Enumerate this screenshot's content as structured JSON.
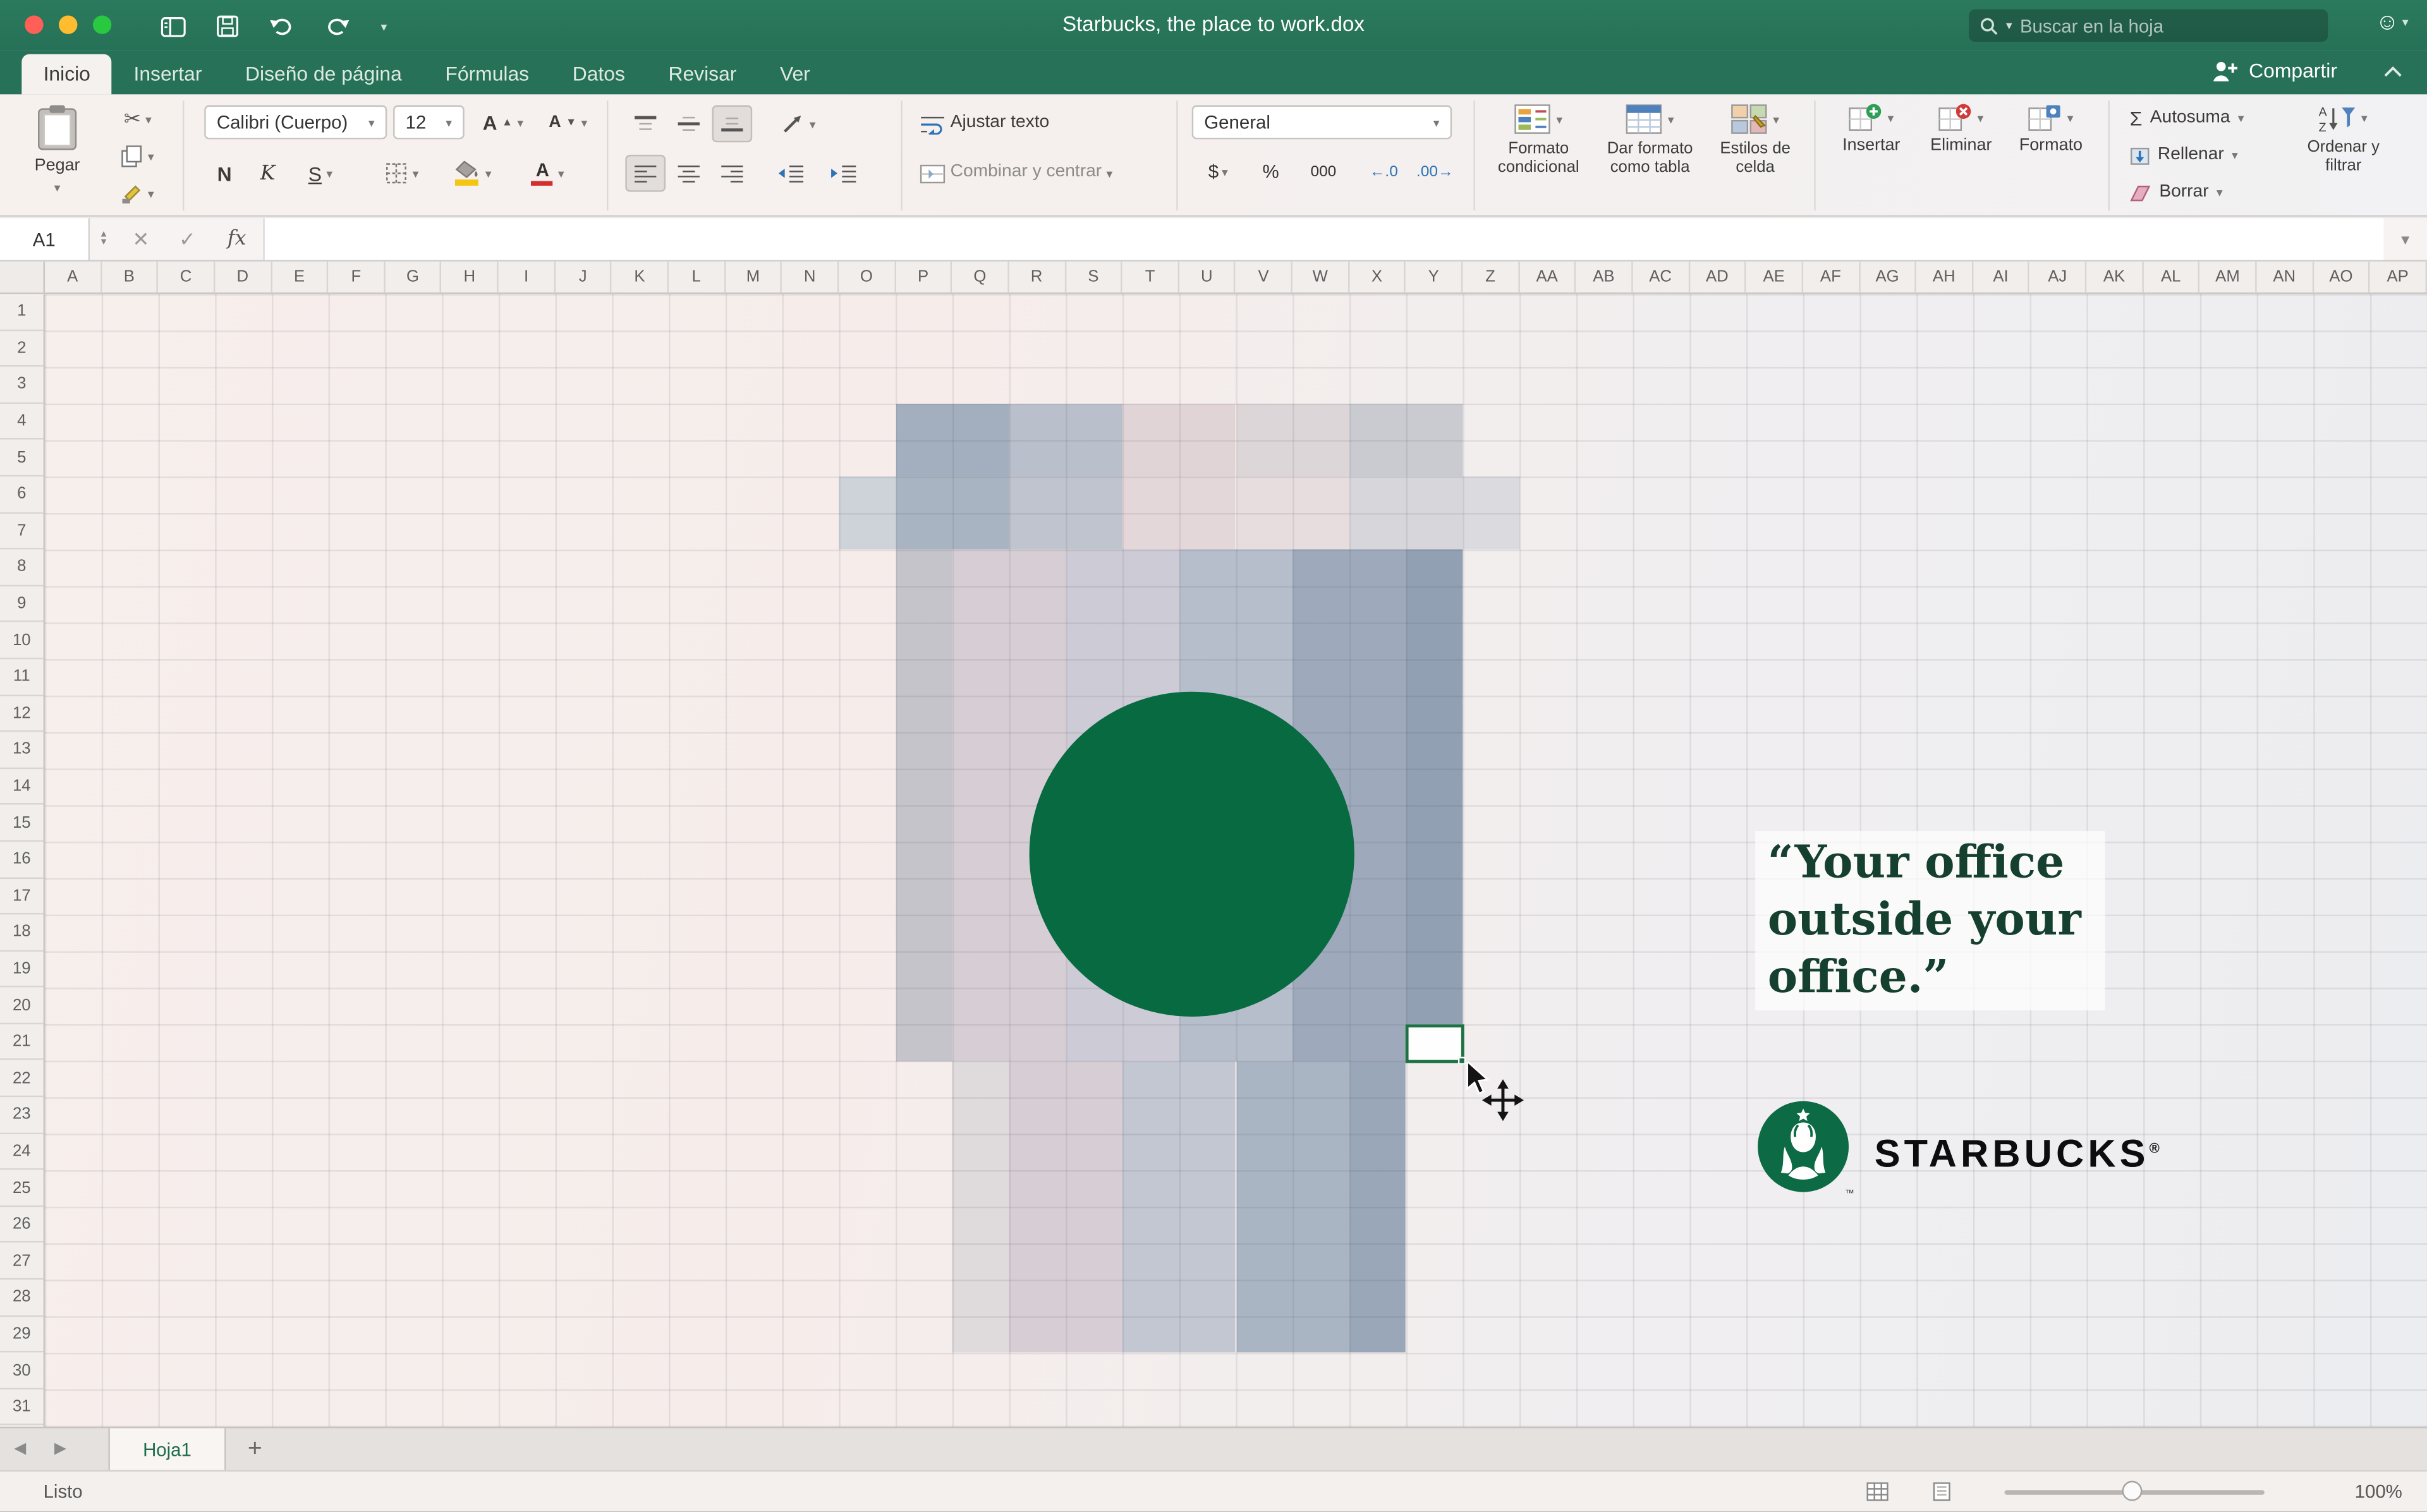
{
  "window": {
    "title": "Starbucks, the place to work.dox",
    "search_placeholder": "Buscar en la hoja"
  },
  "menu_tabs": [
    {
      "label": "Inicio",
      "active": true
    },
    {
      "label": "Insertar",
      "active": false
    },
    {
      "label": "Diseño de página",
      "active": false
    },
    {
      "label": "Fórmulas",
      "active": false
    },
    {
      "label": "Datos",
      "active": false
    },
    {
      "label": "Revisar",
      "active": false
    },
    {
      "label": "Ver",
      "active": false
    }
  ],
  "share_label": "Compartir",
  "ribbon": {
    "paste": "Pegar",
    "font_name": "Calibri (Cuerpo)",
    "font_size": "12",
    "bold": "N",
    "italic": "K",
    "underline": "S",
    "wrap_text": "Ajustar texto",
    "merge_center": "Combinar y centrar",
    "number_format": "General",
    "currency": "$",
    "percent": "%",
    "thousands": "000",
    "increase_decimal": "←.0",
    "decrease_decimal": ".00→",
    "conditional": "Formato condicional",
    "format_table": "Dar formato como tabla",
    "cell_styles": "Estilos de celda",
    "insert": "Insertar",
    "delete": "Eliminar",
    "format": "Formato",
    "autosum_icon": "Σ",
    "autosum": "Autosuma",
    "fill": "Rellenar",
    "clear": "Borrar",
    "sort_filter": "Ordenar y filtrar"
  },
  "formula_bar": {
    "name_box": "A1",
    "fx": "fx"
  },
  "grid": {
    "columns": [
      "A",
      "B",
      "C",
      "D",
      "E",
      "F",
      "G",
      "H",
      "I",
      "J",
      "K",
      "L",
      "M",
      "N",
      "O",
      "P",
      "Q",
      "R",
      "S",
      "T",
      "U",
      "V",
      "W",
      "X",
      "Y",
      "Z",
      "AA",
      "AB",
      "AC",
      "AD",
      "AE",
      "AF",
      "AG",
      "AH",
      "AI",
      "AJ",
      "AK",
      "AL",
      "AM",
      "AN",
      "AO",
      "AP"
    ],
    "rows": [
      "1",
      "2",
      "3",
      "4",
      "5",
      "6",
      "7",
      "8",
      "9",
      "10",
      "11",
      "12",
      "13",
      "14",
      "15",
      "16",
      "17",
      "18",
      "19",
      "20",
      "21",
      "22",
      "23",
      "24",
      "25",
      "26",
      "27",
      "28",
      "29",
      "30",
      "31"
    ]
  },
  "artwork": {
    "logo_circle_color": "#086a41",
    "cells": [
      {
        "c1": 15,
        "c2": 17,
        "r1": 4,
        "r2": 6,
        "color": "#9fabbc"
      },
      {
        "c1": 17,
        "c2": 19,
        "r1": 4,
        "r2": 6,
        "color": "#b6bdc9"
      },
      {
        "c1": 19,
        "c2": 21,
        "r1": 4,
        "r2": 6,
        "color": "#e0d2d5"
      },
      {
        "c1": 21,
        "c2": 23,
        "r1": 4,
        "r2": 6,
        "color": "#dbd4d7"
      },
      {
        "c1": 23,
        "c2": 25,
        "r1": 4,
        "r2": 6,
        "color": "#c7c9cf"
      },
      {
        "c1": 14,
        "c2": 15,
        "r1": 6,
        "r2": 8,
        "color": "#ccd1d7"
      },
      {
        "c1": 15,
        "c2": 17,
        "r1": 6,
        "r2": 8,
        "color": "#a6b1c0"
      },
      {
        "c1": 17,
        "c2": 19,
        "r1": 6,
        "r2": 8,
        "color": "#bcc2cc"
      },
      {
        "c1": 19,
        "c2": 21,
        "r1": 6,
        "r2": 8,
        "color": "#e3d5d7"
      },
      {
        "c1": 21,
        "c2": 23,
        "r1": 6,
        "r2": 8,
        "color": "#e6dcde"
      },
      {
        "c1": 23,
        "c2": 25,
        "r1": 6,
        "r2": 8,
        "color": "#d5d5da"
      },
      {
        "c1": 25,
        "c2": 26,
        "r1": 6,
        "r2": 8,
        "color": "#dadade"
      },
      {
        "c1": 15,
        "c2": 16,
        "r1": 8,
        "r2": 22,
        "color": "#c3c2c8"
      },
      {
        "c1": 16,
        "c2": 18,
        "r1": 8,
        "r2": 22,
        "color": "#d4ccd2"
      },
      {
        "c1": 18,
        "c2": 20,
        "r1": 8,
        "r2": 22,
        "color": "#cbc9d3"
      },
      {
        "c1": 20,
        "c2": 22,
        "r1": 8,
        "r2": 22,
        "color": "#b3bbca"
      },
      {
        "c1": 22,
        "c2": 24,
        "r1": 8,
        "r2": 22,
        "color": "#9aa7b9"
      },
      {
        "c1": 24,
        "c2": 25,
        "r1": 8,
        "r2": 21,
        "color": "#8e9cb0"
      },
      {
        "c1": 16,
        "c2": 17,
        "r1": 22,
        "r2": 30,
        "color": "#ded8da"
      },
      {
        "c1": 17,
        "c2": 19,
        "r1": 22,
        "r2": 30,
        "color": "#d4ccd2"
      },
      {
        "c1": 19,
        "c2": 21,
        "r1": 22,
        "r2": 30,
        "color": "#c1c5d0"
      },
      {
        "c1": 21,
        "c2": 23,
        "r1": 22,
        "r2": 30,
        "color": "#a7b2c2"
      },
      {
        "c1": 23,
        "c2": 24,
        "r1": 22,
        "r2": 30,
        "color": "#96a3b5"
      }
    ]
  },
  "quote": {
    "lines": [
      "“Your office",
      "outside your",
      "office.”"
    ]
  },
  "brand": {
    "wordmark": "STARBUCKS",
    "registered": "®",
    "trademark": "™"
  },
  "sheet_tabs": {
    "active": "Hoja1",
    "add_label": "+"
  },
  "status_bar": {
    "ready": "Listo",
    "zoom": "100%"
  }
}
